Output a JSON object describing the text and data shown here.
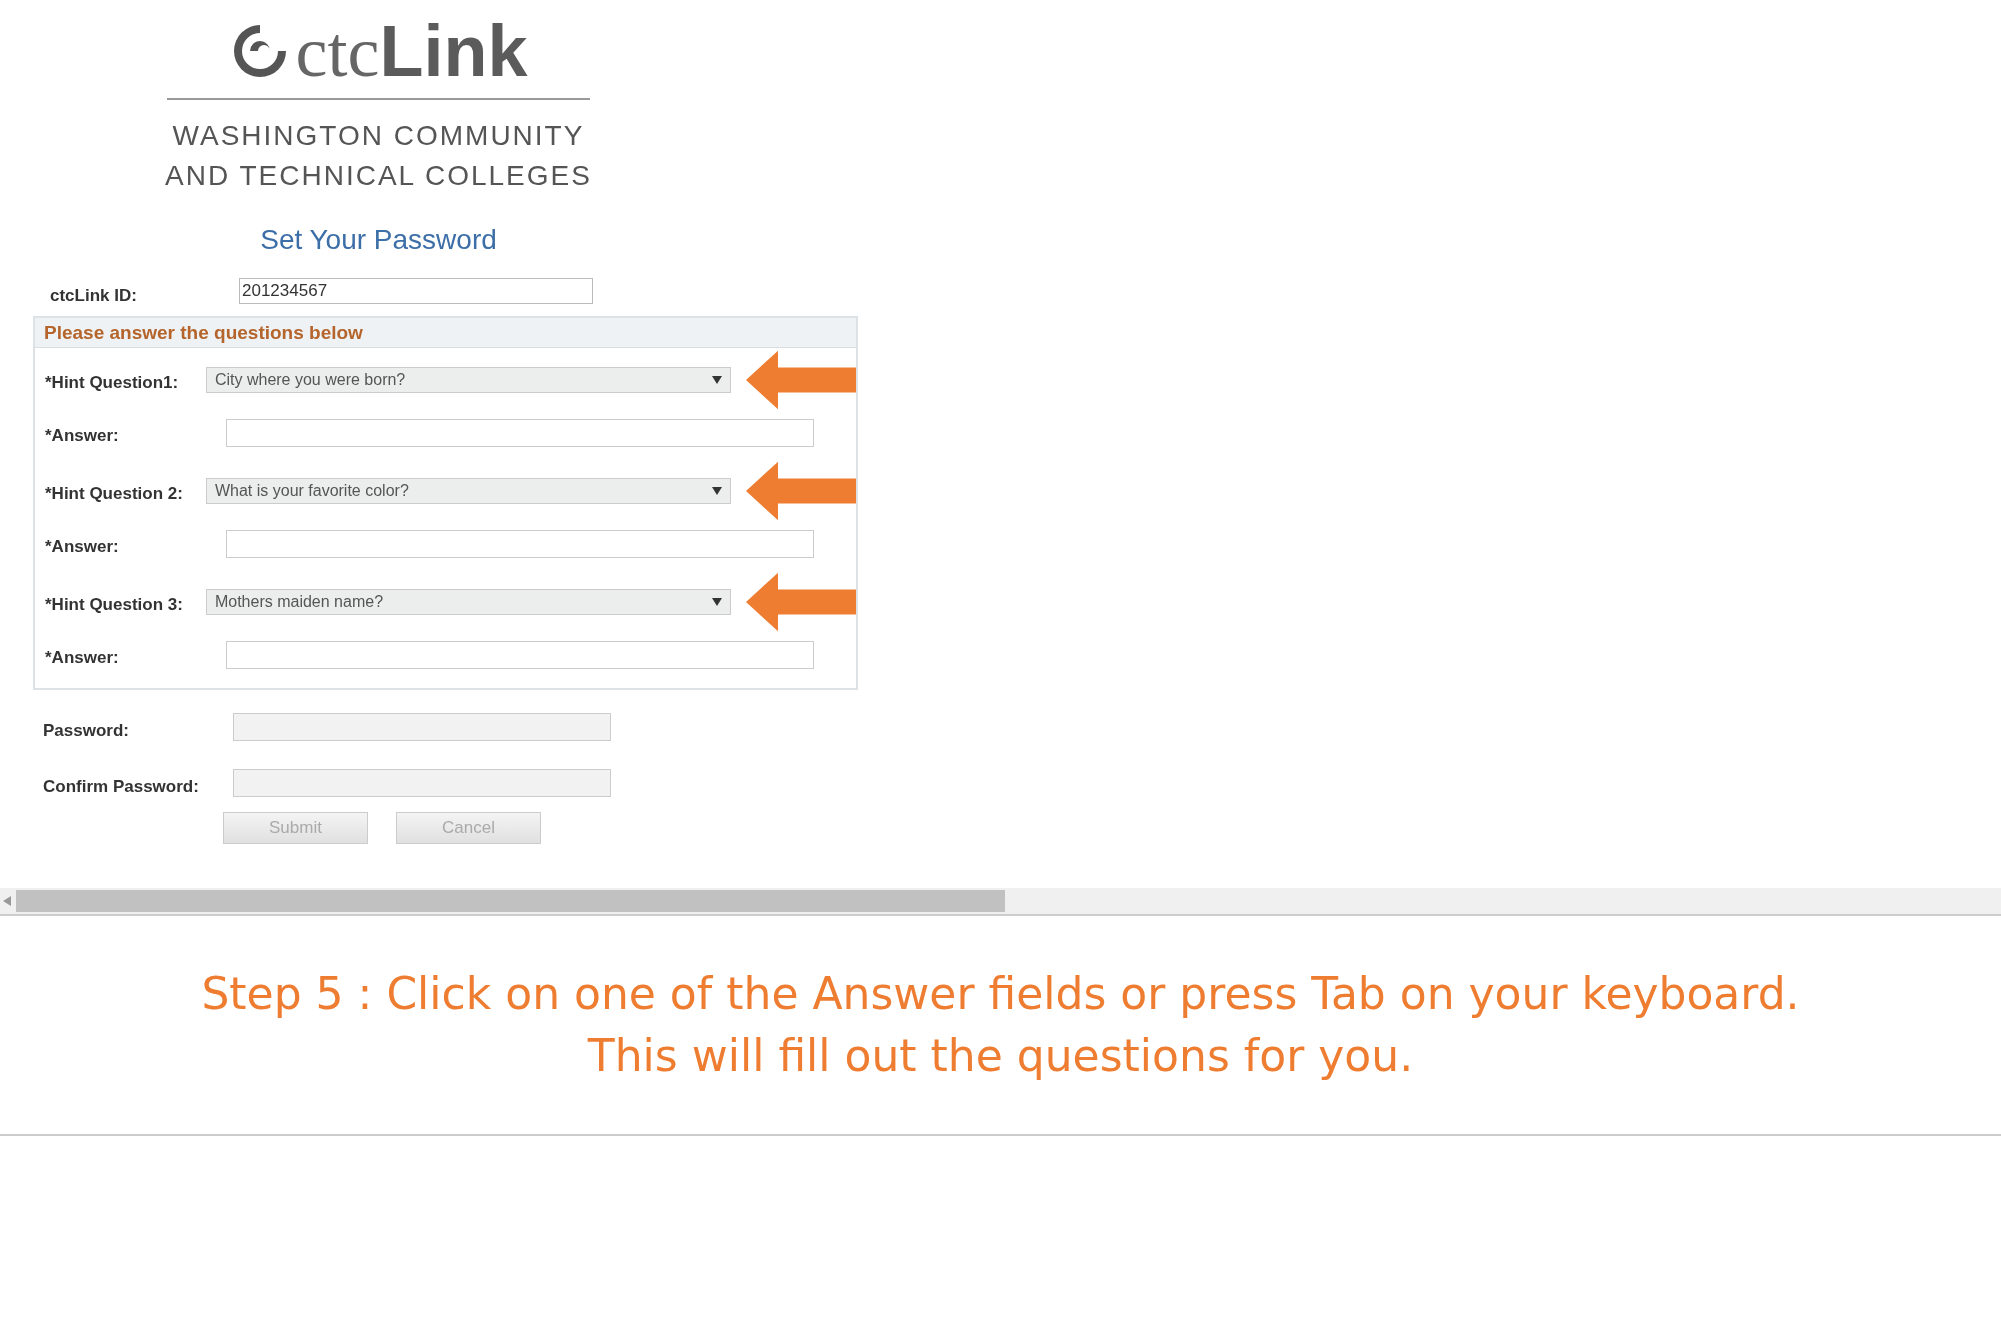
{
  "logo": {
    "wordmark": "ctc**Link**",
    "subtitle_lines": [
      "WASHINGTON COMMUNITY",
      "AND TECHNICAL COLLEGES"
    ]
  },
  "title": "Set Your Password",
  "id_field": {
    "label": "ctcLink ID:",
    "value": "201234567"
  },
  "questions_box": {
    "header": "Please answer the questions below",
    "rows": [
      {
        "label": "*Hint Question1:",
        "value": "City where you were born?",
        "answer_label": "*Answer:",
        "arrow": true
      },
      {
        "label": "*Hint Question 2:",
        "value": "What is your favorite color?",
        "answer_label": "*Answer:",
        "arrow": true
      },
      {
        "label": "*Hint Question 3:",
        "value": "Mothers maiden name?",
        "answer_label": "*Answer:",
        "arrow": true
      }
    ]
  },
  "password_fields": [
    {
      "label": "Password:",
      "disabled": true
    },
    {
      "label": "Confirm Password:",
      "disabled": true
    }
  ],
  "buttons": [
    {
      "label": "Submit",
      "disabled": true
    },
    {
      "label": "Cancel",
      "disabled": true
    }
  ],
  "instruction_lines": [
    "Step 5 : Click on one of the Answer fields or press Tab on your keyboard.",
    "This will fill out the questions for you."
  ]
}
